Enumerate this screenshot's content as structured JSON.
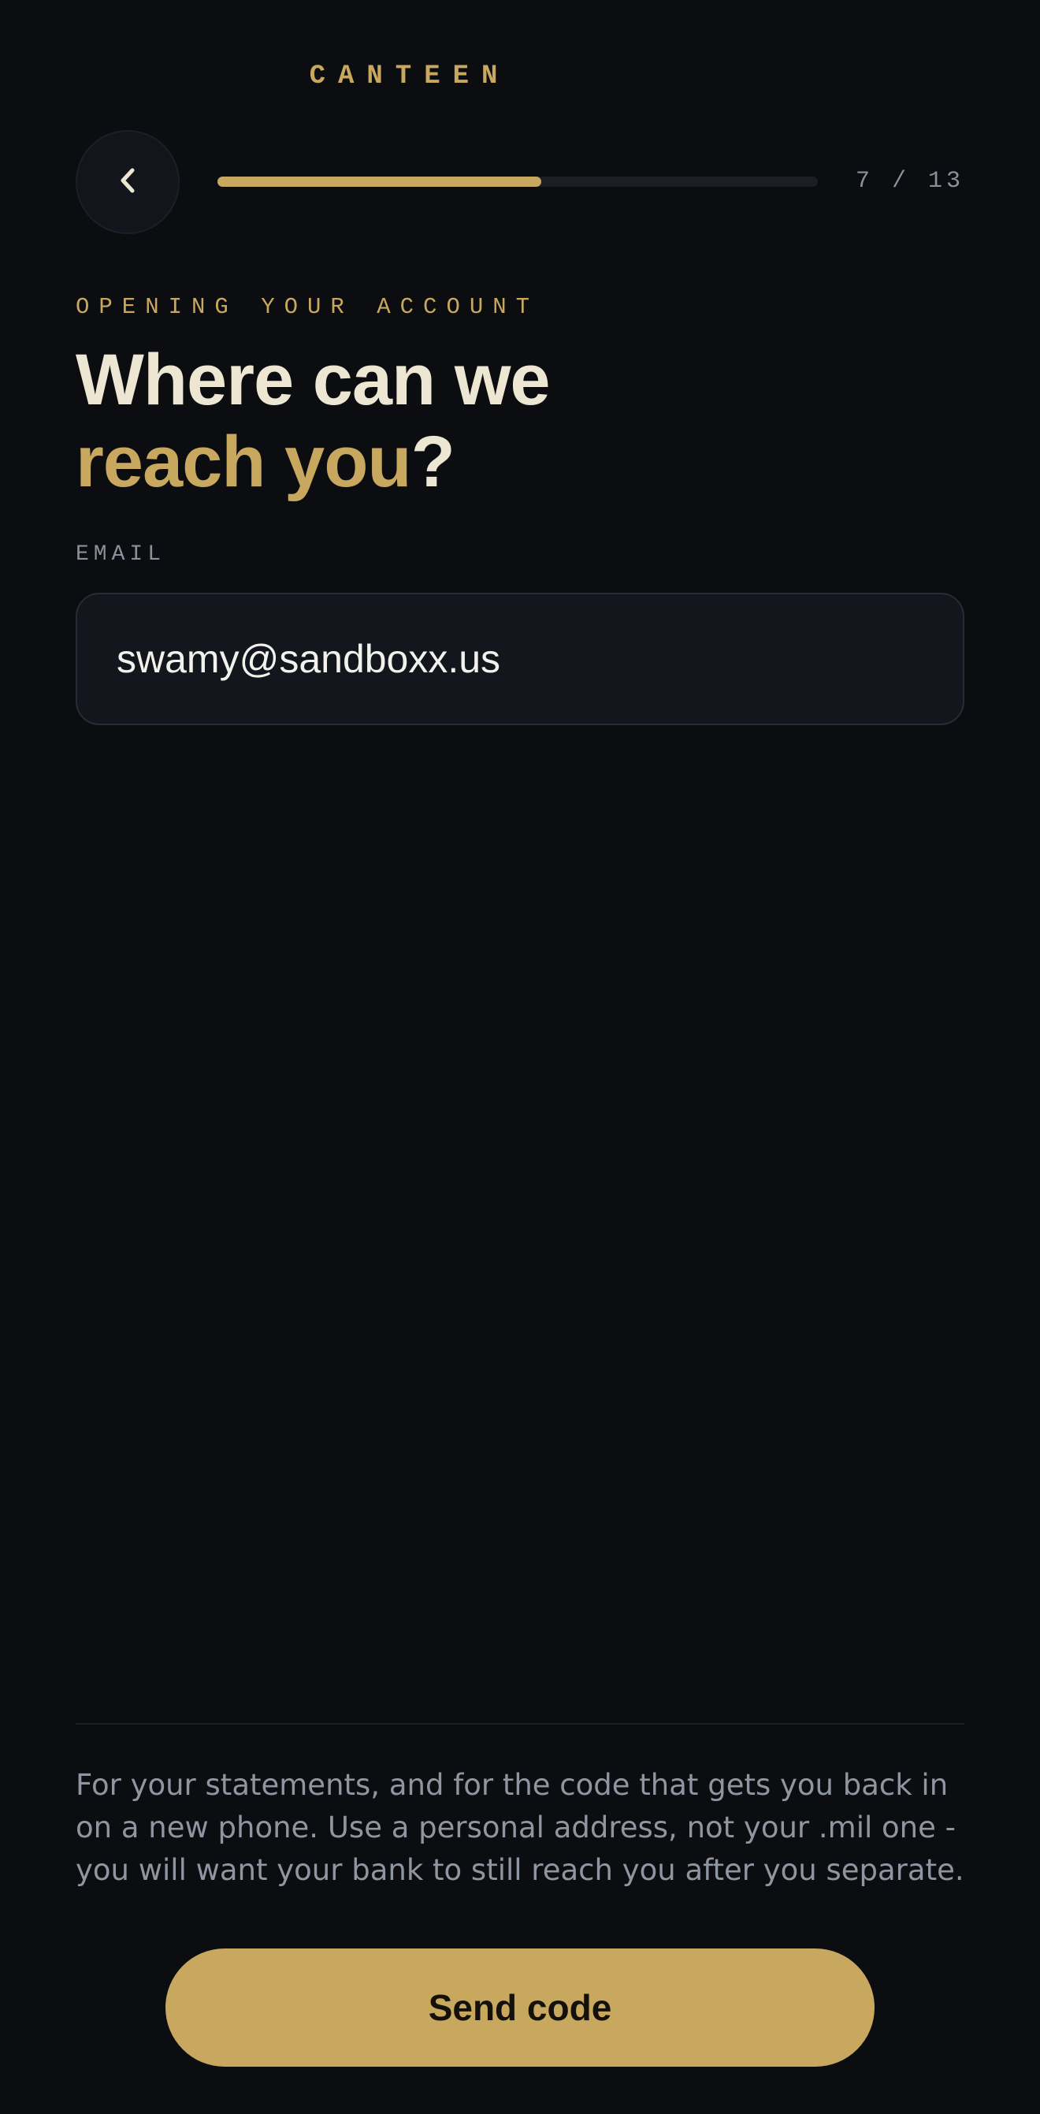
{
  "brand": {
    "name": "CANTEEN",
    "color": "#c8a75f"
  },
  "nav": {
    "back_icon": "chevron-left-icon"
  },
  "progress": {
    "current": 7,
    "total": 13,
    "label": "7 / 13",
    "fraction": 0.54
  },
  "section": {
    "eyebrow": "OPENING YOUR ACCOUNT"
  },
  "headline": {
    "line1": "Where can we",
    "line2_accent": "reach you",
    "line2_suffix": "?"
  },
  "email_field": {
    "label": "EMAIL",
    "value": "swamy@sandboxx.us"
  },
  "helper_text": "For your statements, and for the code that gets you back in on a new phone. Use a personal address, not your .mil one - you will want your bank to still reach you after you separate.",
  "actions": {
    "send_label": "Send code"
  },
  "colors": {
    "background": "#0c0d10",
    "accent": "#c8a75f",
    "text_primary": "#ede6d3",
    "text_muted": "#8b919c"
  }
}
